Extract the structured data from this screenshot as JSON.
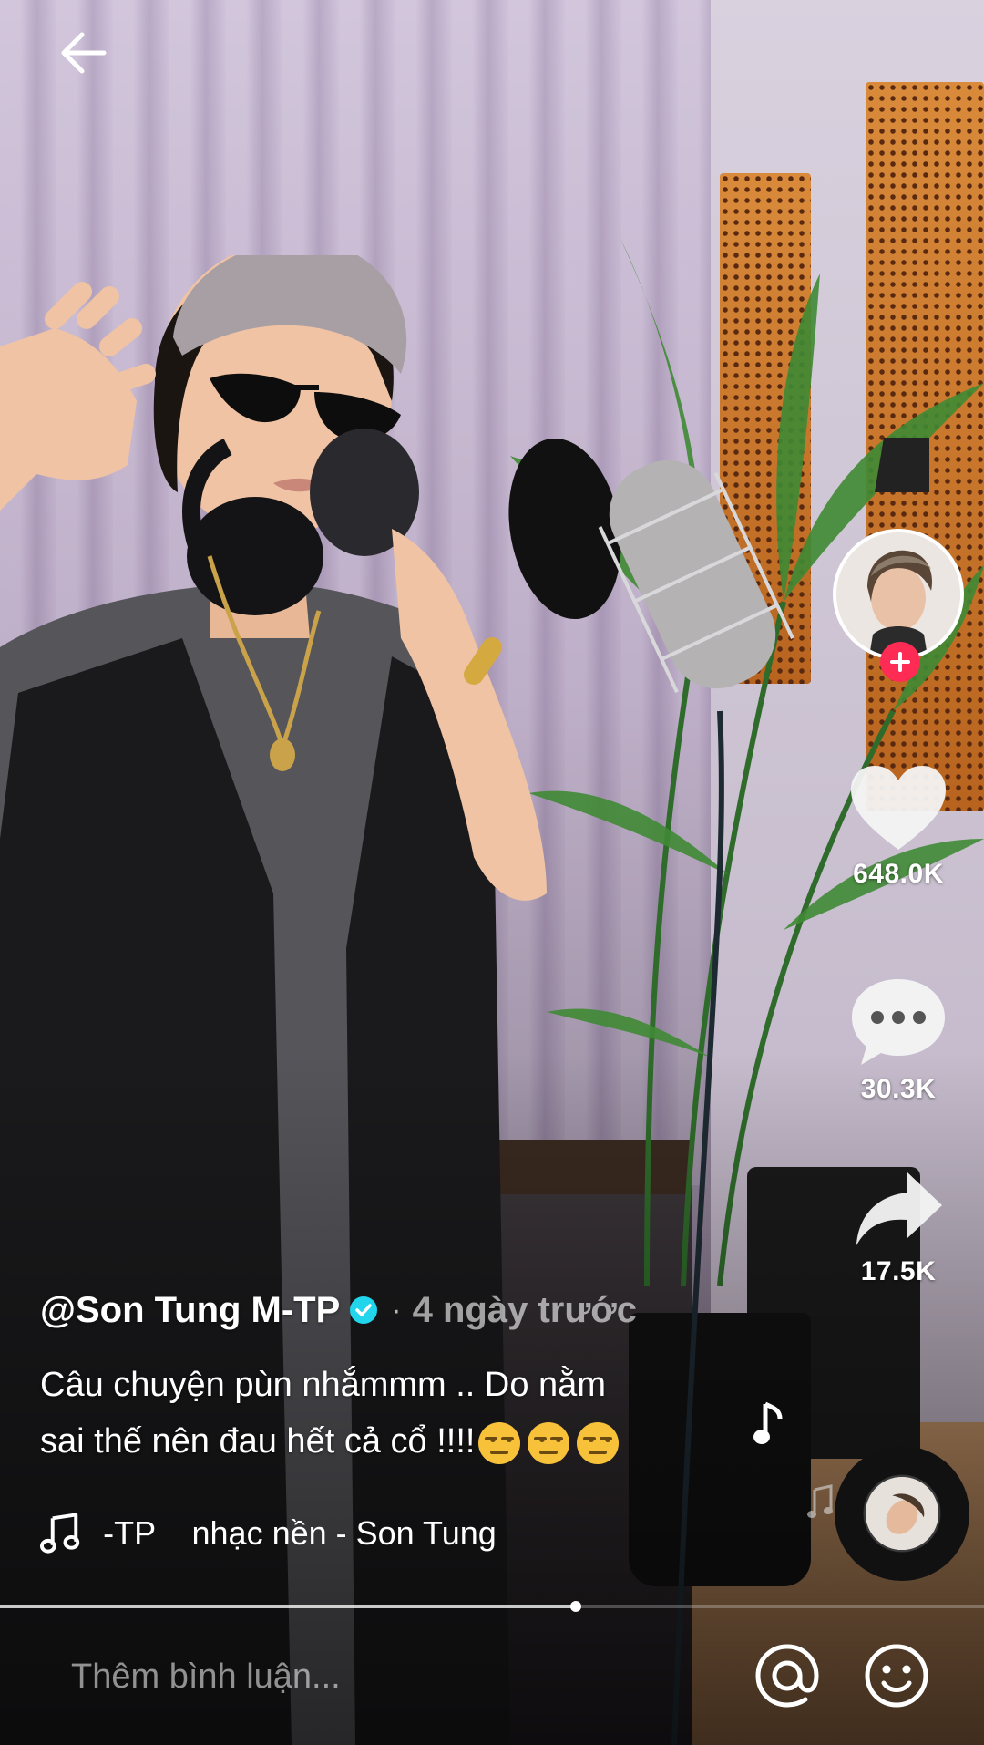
{
  "video": {
    "author": "@Son Tung M-TP",
    "time_ago": "4 ngày trước",
    "separator": "·",
    "caption_line1": "Câu chuyện pùn nhắmmm .. Do nằm",
    "caption_line2": "sai thế nên đau hết cả cổ !!!!",
    "caption_emojis": [
      "unamused-face",
      "unamused-face",
      "unamused-face"
    ],
    "music": "-TP    nhạc nền - Son Tung",
    "progress": 0.585
  },
  "actions": {
    "likes": "648.0K",
    "comments": "30.3K",
    "shares": "17.5K"
  },
  "comment_bar": {
    "placeholder": "Thêm bình luận..."
  },
  "icons": {
    "back": "arrow-left-icon",
    "verified": "verified-badge-icon",
    "like": "heart-icon",
    "comment": "comment-bubble-icon",
    "share": "share-arrow-icon",
    "music": "music-note-icon",
    "mention": "at-sign-icon",
    "emoji": "smiley-icon",
    "follow": "plus-icon"
  },
  "colors": {
    "follow_accent": "#fe2c55",
    "verified": "#20d5ec"
  }
}
